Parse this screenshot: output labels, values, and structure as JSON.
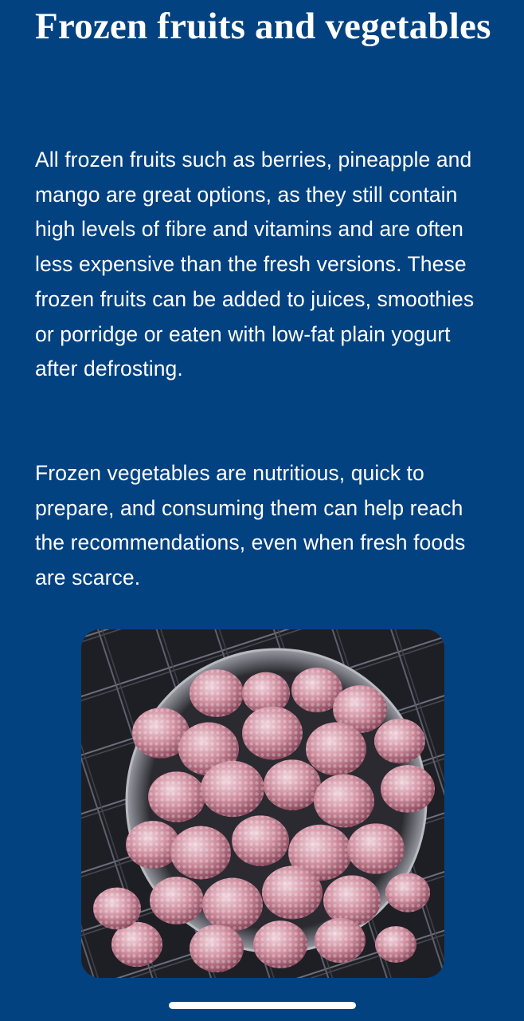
{
  "article": {
    "title": "Frozen fruits and vegetables",
    "paragraphs": [
      "All frozen fruits such as berries, pineapple and mango are great options, as they still contain high levels of fibre and vitamins and are often less expensive than the fresh versions. These frozen fruits can be added to juices, smoothies or porridge or eaten with low-fat plain yogurt after defrosting.",
      "Frozen vegetables are nutritious, quick to prepare, and consuming them can help reach the recommendations, even when fresh foods are scarce."
    ]
  },
  "image": {
    "subject": "frozen raspberries in a metal bowl on a dark plaid cloth"
  },
  "colors": {
    "background": "#034281",
    "text": "#ffffff",
    "berry": "#c98a9a"
  }
}
